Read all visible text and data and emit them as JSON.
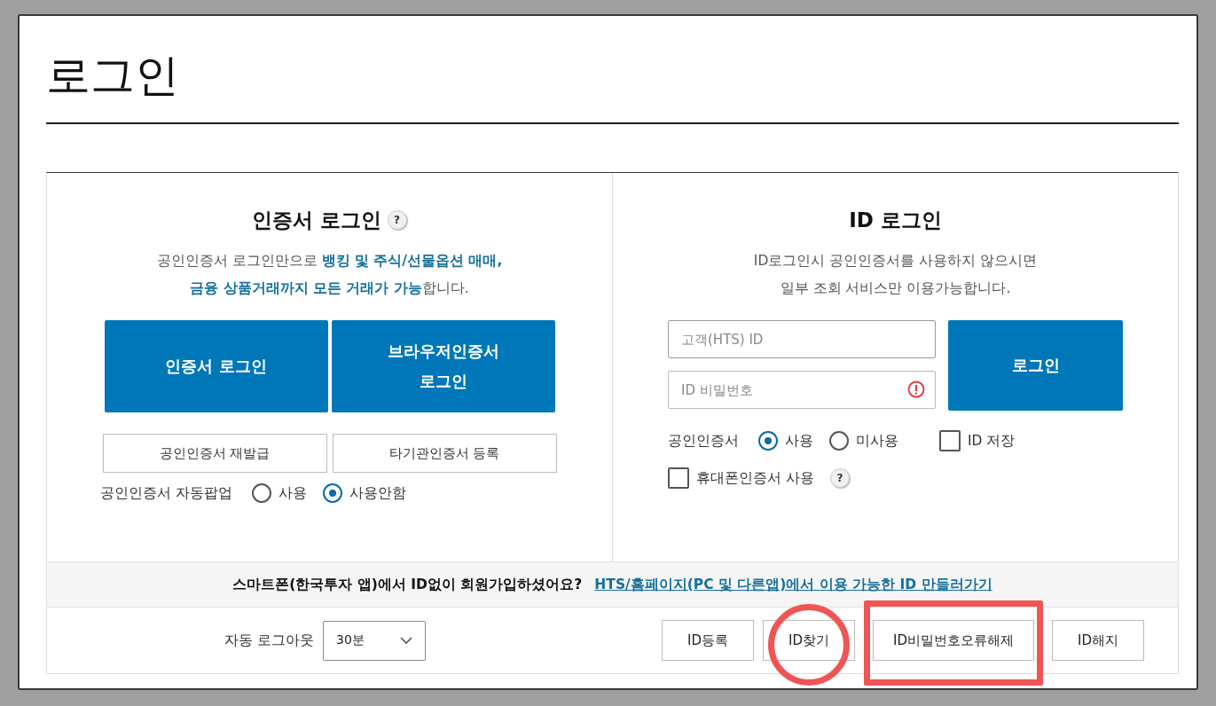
{
  "page_title": "로그인",
  "cert_login": {
    "title": "인증서 로그인",
    "help_icon": "?",
    "description": [
      "공인인증서 로그인만으로 **뱅킹 및 주식/선물옵션 매매,**",
      "**금융 상품거래까지 모든 거래가 가능**합니다."
    ],
    "primary_buttons": [
      {
        "lines": [
          "인증서 로그인"
        ]
      },
      {
        "lines": [
          "브라우저인증서",
          "로그인"
        ]
      }
    ],
    "secondary_buttons": [
      "공인인증서 재발급",
      "타기관인증서 등록"
    ],
    "popup": {
      "label": "공인인증서 자동팝업",
      "options": [
        {
          "label": "사용",
          "selected": false
        },
        {
          "label": "사용안함",
          "selected": true
        }
      ]
    }
  },
  "id_login": {
    "title": "ID 로그인",
    "description": [
      "ID로그인시 공인인증서를 사용하지 않으시면",
      "일부 조회 서비스만 이용가능합니다."
    ],
    "id_field": {
      "placeholder": "고객(HTS) ID"
    },
    "password_field": {
      "placeholder": "ID 비밀번호"
    },
    "login_button": "로그인",
    "cert": {
      "label": "공인인증서",
      "options": [
        {
          "label": "사용",
          "selected": true
        },
        {
          "label": "미사용",
          "selected": false
        }
      ]
    },
    "save_id": {
      "label": "ID 저장",
      "checked": false
    },
    "mobile_cert": {
      "label": "휴대폰인증서 사용",
      "checked": false,
      "help_icon": "?"
    }
  },
  "notice": {
    "text": "스마트폰(한국투자 앱)에서 ID없이 회원가입하셨어요?",
    "link": "HTS/홈페이지(PC 및 다른앱)에서 이용 가능한 ID 만들러가기"
  },
  "auto_logout": {
    "label": "자동 로그아웃",
    "value": "30분"
  },
  "id_buttons": [
    {
      "label": "ID등록",
      "kind": "plain"
    },
    {
      "label": "ID찾기",
      "kind": "circled"
    },
    {
      "label": "ID비밀번호오류해제",
      "kind": "boxed"
    },
    {
      "label": "ID해지",
      "kind": "plain"
    }
  ]
}
